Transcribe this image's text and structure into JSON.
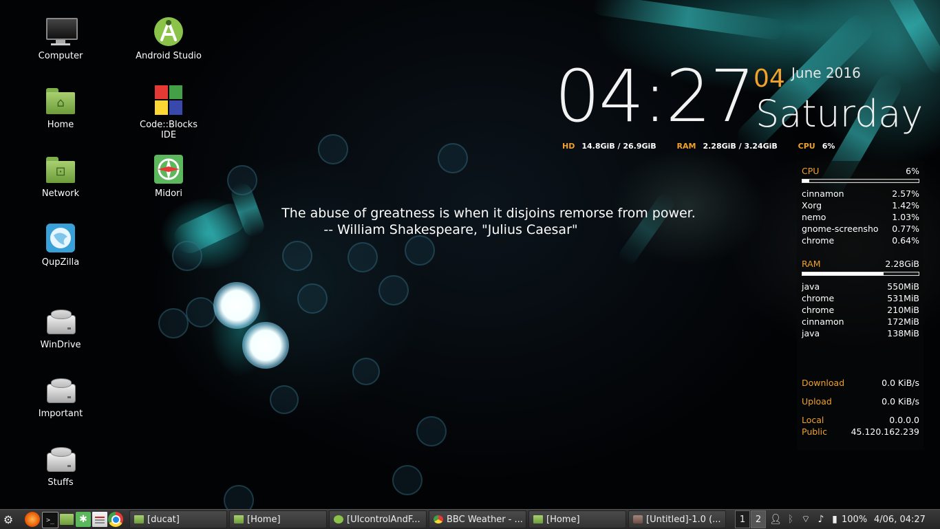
{
  "desktop_icons": [
    {
      "id": "computer",
      "label": "Computer"
    },
    {
      "id": "android-studio",
      "label": "Android Studio"
    },
    {
      "id": "home",
      "label": "Home"
    },
    {
      "id": "codeblocks",
      "label": "Code::Blocks IDE"
    },
    {
      "id": "network",
      "label": "Network"
    },
    {
      "id": "midori",
      "label": "Midori"
    },
    {
      "id": "qupzilla",
      "label": "QupZilla"
    },
    {
      "id": "windrive",
      "label": "WinDrive"
    },
    {
      "id": "important",
      "label": "Important"
    },
    {
      "id": "stuffs",
      "label": "Stuffs"
    }
  ],
  "clock": {
    "time": "04:27",
    "day": "04",
    "month_year": "June 2016",
    "weekday": "Saturday"
  },
  "sysline": {
    "hd_label": "HD",
    "hd_value": "14.8GiB / 26.9GiB",
    "ram_label": "RAM",
    "ram_value": "2.28GiB / 3.24GiB",
    "cpu_label": "CPU",
    "cpu_value": "6%"
  },
  "quote": {
    "line1": "The abuse of greatness is when it disjoins remorse from power.",
    "line2": "-- William Shakespeare, \"Julius Caesar\""
  },
  "monitor": {
    "cpu": {
      "label": "CPU",
      "value": "6%",
      "usage_fraction": 0.06,
      "procs": [
        {
          "name": "cinnamon",
          "value": "2.57%"
        },
        {
          "name": "Xorg",
          "value": "1.42%"
        },
        {
          "name": "nemo",
          "value": "1.03%"
        },
        {
          "name": "gnome-screensho",
          "value": "0.77%"
        },
        {
          "name": "chrome",
          "value": "0.64%"
        }
      ]
    },
    "ram": {
      "label": "RAM",
      "value": "2.28GiB",
      "usage_fraction": 0.7,
      "procs": [
        {
          "name": "java",
          "value": "550MiB"
        },
        {
          "name": "chrome",
          "value": "531MiB"
        },
        {
          "name": "chrome",
          "value": "210MiB"
        },
        {
          "name": "cinnamon",
          "value": "172MiB"
        },
        {
          "name": "java",
          "value": "138MiB"
        }
      ]
    },
    "net": {
      "download_label": "Download",
      "download_value": "0.0 KiB/s",
      "upload_label": "Upload",
      "upload_value": "0.0 KiB/s",
      "local_label": "Local",
      "local_value": "0.0.0.0",
      "public_label": "Public",
      "public_value": "45.120.162.239"
    }
  },
  "taskbar": {
    "windows": [
      {
        "label": "[ducat]",
        "icon": "folder-icon"
      },
      {
        "label": "[Home]",
        "icon": "folder-icon"
      },
      {
        "label": "[UIcontrolAndF...",
        "icon": "android-studio-icon"
      },
      {
        "label": "BBC Weather - ...",
        "icon": "chrome-icon"
      },
      {
        "label": "[Home]",
        "icon": "folder-icon"
      },
      {
        "label": "[Untitled]-1.0 (...",
        "icon": "gimp-icon"
      }
    ],
    "workspaces": [
      "1",
      "2"
    ],
    "battery": "100%",
    "datetime": "4/06, 04:27"
  },
  "colors": {
    "accent_orange": "#f0a22a",
    "text_white": "#ffffff",
    "panel_bg": "#2e2e2e"
  }
}
